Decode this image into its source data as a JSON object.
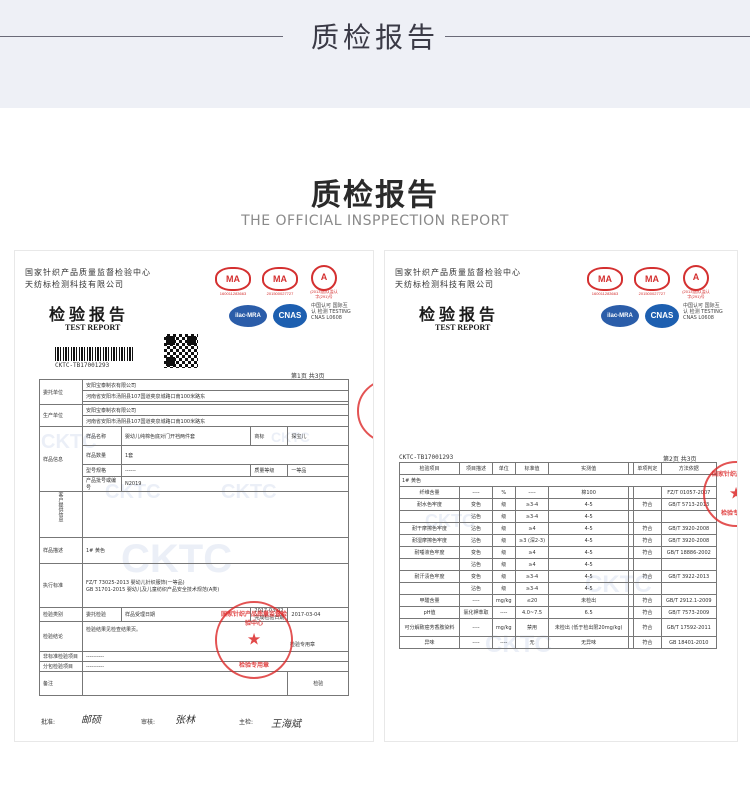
{
  "band": {
    "title": "质检报告"
  },
  "heading": {
    "title": "质检报告",
    "subtitle": "THE OFFICIAL INSPPECTION REPORT"
  },
  "institute": {
    "line1": "国家针织产品质量监督检验中心",
    "line2": "天纺标检测科技有限公司"
  },
  "report": {
    "title": "检验报告",
    "title_en": "TEST REPORT"
  },
  "logos": {
    "cma1": "MA",
    "cma1_no": "160011283663",
    "cma2": "MA",
    "cma2_no": "201500027727",
    "cal": "A",
    "cal_no": "(2013)国认监认字(291)号",
    "ilac": "ilac-MRA",
    "cnas": "CNAS",
    "cnas_text": "中国认可 国际互认 检测 TESTING CNAS L0608"
  },
  "page1": {
    "code": "CKTC-TB17001293",
    "page_no": "第1页   共3页",
    "rows": {
      "client_label": "委托单位",
      "client_name": "安阳宝泰制衣有限公司",
      "client_addr": "河南省安阳市汤阴县107国道奕泉城路口南100米路东",
      "maker_label": "生产单位",
      "maker_name": "安阳宝泰制衣有限公司",
      "maker_addr": "河南省安阳市汤阴县107国道奕泉城路口南100米路东",
      "sample_label": "样品信息",
      "name_label": "样品名称",
      "name_value": "婴幼儿纯棉色底对门开裆两件套",
      "brand_label": "商标",
      "brand_value": "探宝儿",
      "qty_label": "样品数量",
      "qty_value": "1套",
      "model_label": "型号规格",
      "model_value": "------",
      "grade_label": "质量等级",
      "grade_value": "一等品",
      "batch_label": "产品批号或编号",
      "batch_value": "N2019",
      "side_label": "客户提供信息",
      "desc_label": "样品描述",
      "desc_value": "1# 黄色",
      "std_label": "执行标准",
      "std_value1": "FZ/T 73025-2013   婴幼儿针织服饰(一等品)",
      "std_value2": "GB 31701-2015   婴幼儿及儿童纺织产品安全技术规范(A类)",
      "type_label": "检验类别",
      "type_value": "委托检验",
      "recv_label": "样品受理日期",
      "recv_value": "2017-03-02",
      "done_label": "完成检验日期",
      "done_value": "2017-03-04",
      "conc_label": "检验结论",
      "conc_value": "检验结果见检查结果页。",
      "conc_stamp": "检验专用章",
      "non_label": "非标准检验项目",
      "non_value": "----------",
      "sub_label": "分包检验项目",
      "sub_value": "----------",
      "remark_label": "备注",
      "remark_value": "",
      "right_label": "检验",
      "right_value": "------"
    },
    "stamp": {
      "ring": "国家针织产品质量监督检验中心",
      "btm": "检验专用章"
    },
    "sign": {
      "approve_label": "批准:",
      "audit_label": "审核:",
      "main_label": "主检:",
      "approve": "邮硕",
      "audit": "张林",
      "main": "王海斌"
    }
  },
  "page2": {
    "code": "CKTC-TB17001293",
    "page_no": "第2页   共3页",
    "headers": [
      "检验项目",
      "项目描述",
      "单位",
      "标准值",
      "实测值",
      "",
      "单项判定",
      "方法依据"
    ],
    "sample_row": "1# 黄色",
    "rows": [
      [
        "纤维含量",
        "----",
        "%",
        "----",
        "棉100",
        "",
        "",
        "FZ/T 01057-2007"
      ],
      [
        "耐水色牢度",
        "变色",
        "级",
        "≥3-4",
        "4-5",
        "",
        "符合",
        "GB/T 5713-2013"
      ],
      [
        "",
        "沾色",
        "级",
        "≥3-4",
        "4-5",
        "",
        "",
        ""
      ],
      [
        "耐干摩擦色牢度",
        "沾色",
        "级",
        "≥4",
        "4-5",
        "",
        "符合",
        "GB/T 3920-2008"
      ],
      [
        "耐湿摩擦色牢度",
        "沾色",
        "级",
        "≥3 (深2-3)",
        "4-5",
        "",
        "符合",
        "GB/T 3920-2008"
      ],
      [
        "耐唾液色牢度",
        "变色",
        "级",
        "≥4",
        "4-5",
        "",
        "符合",
        "GB/T 18886-2002"
      ],
      [
        "",
        "沾色",
        "级",
        "≥4",
        "4-5",
        "",
        "",
        ""
      ],
      [
        "耐汗渍色牢度",
        "变色",
        "级",
        "≥3-4",
        "4-5",
        "",
        "符合",
        "GB/T 3922-2013"
      ],
      [
        "",
        "沾色",
        "级",
        "≥3-4",
        "4-5",
        "",
        "",
        ""
      ],
      [
        "甲醛含量",
        "----",
        "mg/kg",
        "≤20",
        "未检出",
        "",
        "符合",
        "GB/T 2912.1-2009"
      ],
      [
        "pH值",
        "氯化钾萃取",
        "----",
        "4.0~7.5",
        "6.5",
        "",
        "符合",
        "GB/T 7573-2009"
      ],
      [
        "可分解致癌芳香胺染料",
        "----",
        "mg/kg",
        "禁用",
        "未检出 (低于检出限20mg/kg)",
        "",
        "符合",
        "GB/T 17592-2011"
      ],
      [
        "异味",
        "----",
        "----",
        "无",
        "无异味",
        "",
        "符合",
        "GB 18401-2010"
      ]
    ],
    "stamp": {
      "ring": "国家针织产品质量",
      "btm": "检验专用章"
    }
  },
  "watermark": "CKTC"
}
